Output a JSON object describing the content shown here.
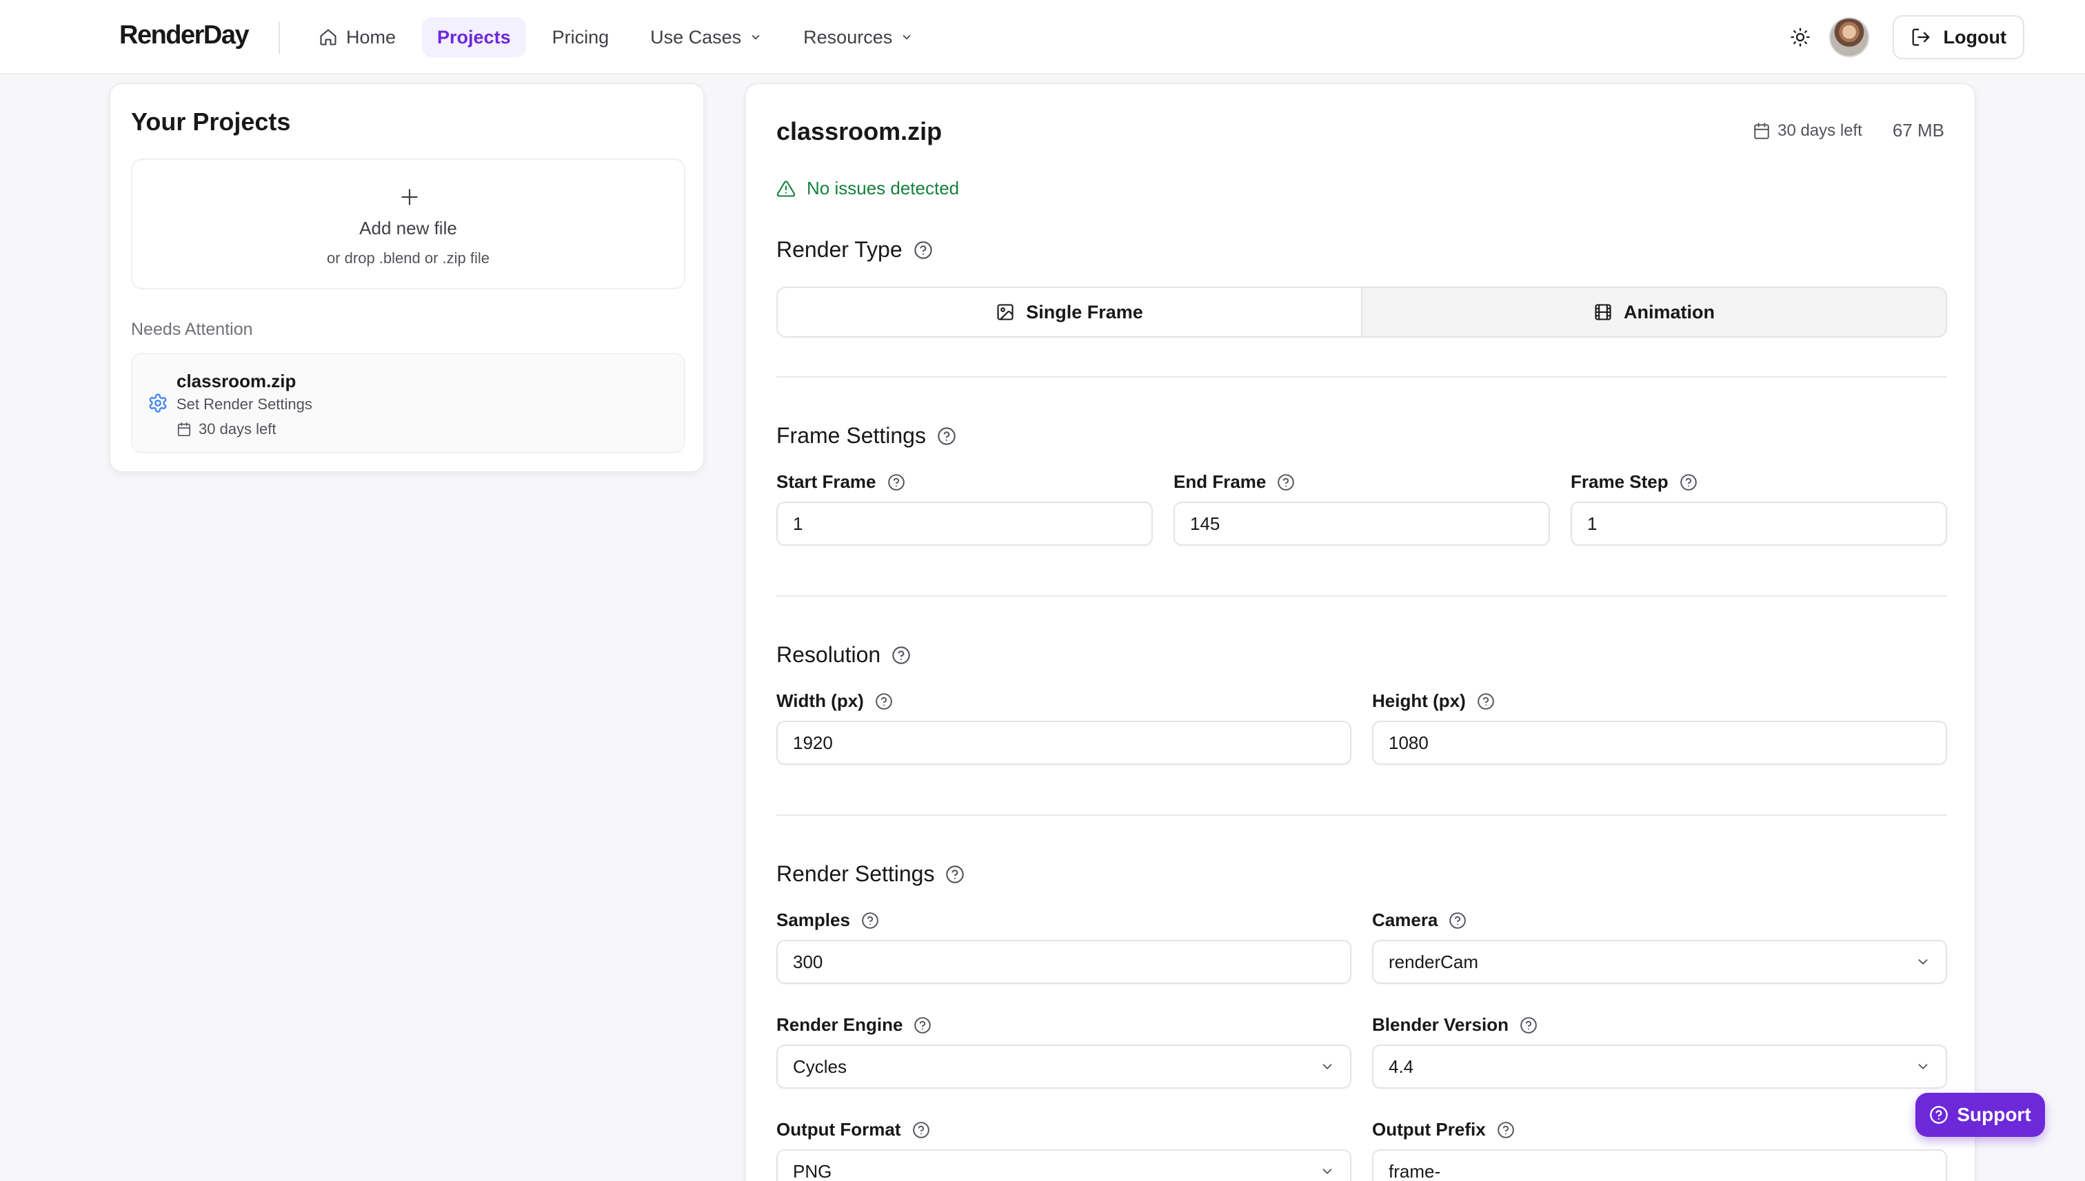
{
  "header": {
    "logo": "RenderDay",
    "nav": [
      {
        "label": "Home",
        "icon": "home-icon",
        "active": false
      },
      {
        "label": "Projects",
        "active": true
      },
      {
        "label": "Pricing",
        "active": false
      },
      {
        "label": "Use Cases",
        "dropdown": true
      },
      {
        "label": "Resources",
        "dropdown": true
      }
    ],
    "logout_label": "Logout"
  },
  "projects_panel": {
    "title": "Your Projects",
    "add_file": {
      "title": "Add new file",
      "subtitle": "or drop .blend or .zip file"
    },
    "needs_attention_label": "Needs Attention",
    "items": [
      {
        "name": "classroom.zip",
        "status": "Set Render Settings",
        "days_left": "30 days left"
      }
    ]
  },
  "file": {
    "name": "classroom.zip",
    "days_left": "30 days left",
    "size": "67 MB",
    "issues": "No issues detected"
  },
  "render_type": {
    "title": "Render Type",
    "options": [
      {
        "label": "Single Frame",
        "selected": true
      },
      {
        "label": "Animation",
        "selected": false
      }
    ]
  },
  "frame_settings": {
    "title": "Frame Settings",
    "start": {
      "label": "Start Frame",
      "value": "1"
    },
    "end": {
      "label": "End Frame",
      "value": "145"
    },
    "step": {
      "label": "Frame Step",
      "value": "1"
    }
  },
  "resolution": {
    "title": "Resolution",
    "width": {
      "label": "Width (px)",
      "value": "1920"
    },
    "height": {
      "label": "Height (px)",
      "value": "1080"
    }
  },
  "render_settings": {
    "title": "Render Settings",
    "samples": {
      "label": "Samples",
      "value": "300"
    },
    "camera": {
      "label": "Camera",
      "value": "renderCam"
    },
    "engine": {
      "label": "Render Engine",
      "value": "Cycles"
    },
    "blender_version": {
      "label": "Blender Version",
      "value": "4.4"
    },
    "output_format": {
      "label": "Output Format",
      "value": "PNG"
    },
    "output_prefix": {
      "label": "Output Prefix",
      "value": "frame-"
    }
  },
  "support_label": "Support",
  "colors": {
    "accent": "#6d28d9",
    "success": "#15803d",
    "info": "#3b82f6"
  }
}
